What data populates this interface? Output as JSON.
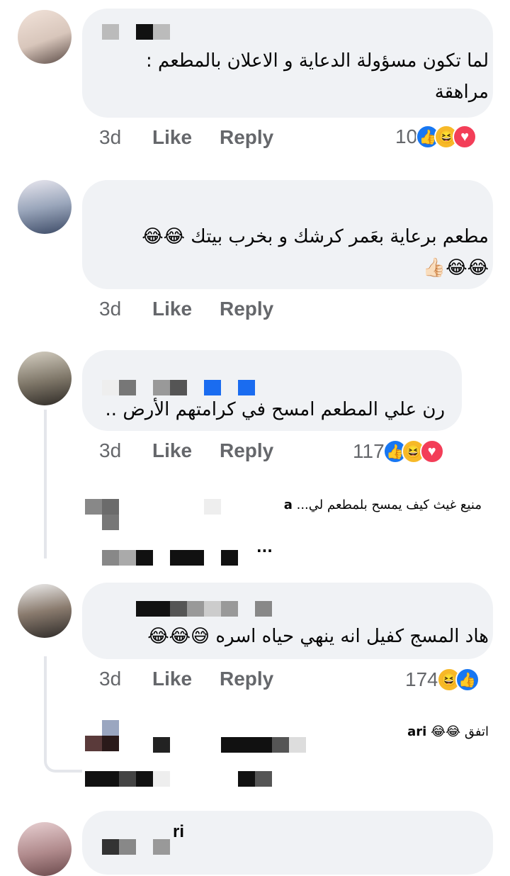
{
  "comments": [
    {
      "text_line1": "لما تكون مسؤولة الدعاية و الاعلان بالمطعم :",
      "text_line2": "مراهقة",
      "time": "3d",
      "like": "Like",
      "reply": "Reply",
      "reaction_count": "10"
    },
    {
      "text_line1": "مطعم برعاية بعَمر كرشك و بخرب بيتك 😂😂",
      "text_line2": "😂😂👍🏻",
      "time": "3d",
      "like": "Like",
      "reply": "Reply"
    },
    {
      "text_line1": "رن علي المطعم امسح في كرامتهم الأرض ..",
      "time": "3d",
      "like": "Like",
      "reply": "Reply",
      "reaction_count": "117"
    },
    {
      "text_line1": "هاد المسج كفيل انه ينهي حياه اسره 😅😂😂",
      "time": "3d",
      "like": "Like",
      "reply": "Reply",
      "reaction_count": "174"
    },
    {
      "name_fragment": "ri"
    }
  ],
  "replies": [
    {
      "text": "منيع غيث كيف يمسح بلمطعم لي...",
      "name_fragment": "a",
      "ellipsis": "..."
    },
    {
      "text": "اتفق 😂😂",
      "name_fragment": "ari"
    }
  ],
  "icons": {
    "like_reaction": "thumbs-up-icon",
    "haha_reaction": "laughing-face-icon",
    "love_reaction": "heart-icon"
  },
  "colors": {
    "bubble": "#f0f2f5",
    "meta_text": "#65676b",
    "like_blue": "#1877f2",
    "love_red": "#f33e58",
    "haha_yellow": "#f7b928"
  }
}
